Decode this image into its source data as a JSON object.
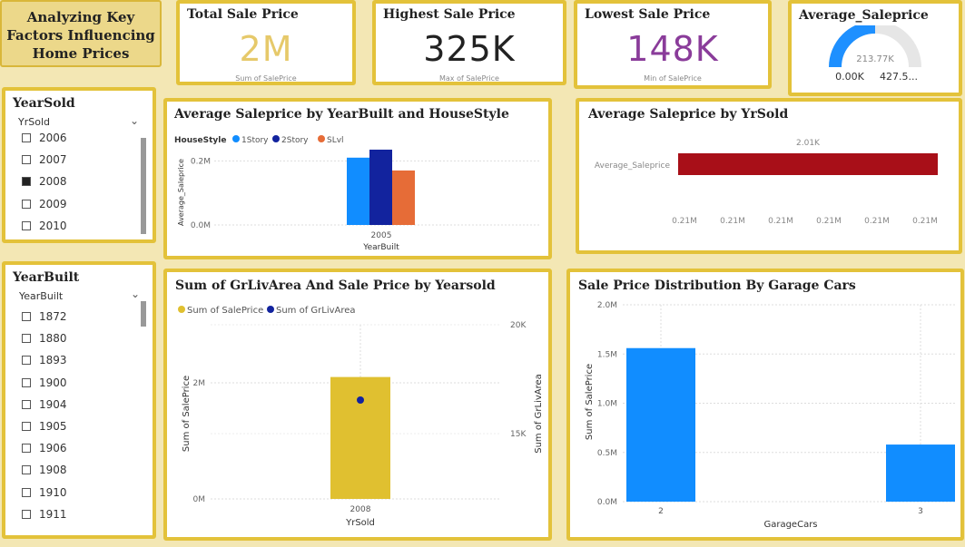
{
  "header": {
    "title_line1": "Analyzing Key",
    "title_line2": "Factors Influencing",
    "title_line3": "Home Prices"
  },
  "kpis": {
    "total": {
      "title": "Total Sale Price",
      "value": "2M",
      "sub": "Sum of SalePrice",
      "color": "#e6c96a"
    },
    "highest": {
      "title": "Highest Sale Price",
      "value": "325K",
      "sub": "Max of SalePrice",
      "color": "#222222"
    },
    "lowest": {
      "title": "Lowest Sale Price",
      "value": "148K",
      "sub": "Min of SalePrice",
      "color": "#8a3c9a"
    }
  },
  "gauge": {
    "title": "Average_Saleprice",
    "value_label": "213.77K",
    "min_label": "0.00K",
    "max_label": "427.5...",
    "fraction": 0.5,
    "color": "#1e90ff"
  },
  "yearsold_slicer": {
    "title": "YearSold",
    "field": "YrSold",
    "items": [
      {
        "label": "2006",
        "checked": false
      },
      {
        "label": "2007",
        "checked": false
      },
      {
        "label": "2008",
        "checked": true
      },
      {
        "label": "2009",
        "checked": false
      },
      {
        "label": "2010",
        "checked": false
      }
    ]
  },
  "yearbuilt_slicer": {
    "title": "YearBuilt",
    "field": "YearBuilt",
    "items": [
      {
        "label": "1872",
        "checked": false
      },
      {
        "label": "1880",
        "checked": false
      },
      {
        "label": "1893",
        "checked": false
      },
      {
        "label": "1900",
        "checked": false
      },
      {
        "label": "1904",
        "checked": false
      },
      {
        "label": "1905",
        "checked": false
      },
      {
        "label": "1906",
        "checked": false
      },
      {
        "label": "1908",
        "checked": false
      },
      {
        "label": "1910",
        "checked": false
      },
      {
        "label": "1911",
        "checked": false
      }
    ]
  },
  "chart_data": [
    {
      "id": "housestyle",
      "type": "bar",
      "title": "Average Saleprice by YearBuilt and HouseStyle",
      "legend_title": "HouseStyle",
      "categories": [
        "2005"
      ],
      "xlabel": "YearBuilt",
      "ylabel": "Average_Saleprice",
      "y_ticks": [
        "0.0M",
        "0.2M"
      ],
      "ylim": [
        0,
        0.3
      ],
      "series": [
        {
          "name": "1Story",
          "values": [
            0.21
          ],
          "color": "#118dff"
        },
        {
          "name": "2Story",
          "values": [
            0.235
          ],
          "color": "#12239e"
        },
        {
          "name": "SLvl",
          "values": [
            0.17
          ],
          "color": "#e66c37"
        }
      ]
    },
    {
      "id": "yrsold",
      "type": "bar",
      "title": "Average Saleprice by YrSold",
      "orientation": "horizontal",
      "categories": [
        "Average_Saleprice"
      ],
      "values": [
        0.21
      ],
      "data_label": "2.01K",
      "x_ticks": [
        "0.21M",
        "0.21M",
        "0.21M",
        "0.21M",
        "0.21M",
        "0.21M"
      ],
      "color": "#a80f18"
    },
    {
      "id": "grlivarea",
      "type": "bar",
      "title": "Sum of GrLivArea And Sale Price by Yearsold",
      "categories": [
        "2008"
      ],
      "xlabel": "YrSold",
      "ylabel": "Sum of SalePrice",
      "y2label": "Sum of GrLivArea",
      "y_ticks": [
        "0M",
        "2M"
      ],
      "y2_ticks": [
        "15K",
        "20K"
      ],
      "series": [
        {
          "name": "Sum of SalePrice",
          "values": [
            2.1
          ],
          "color": "#e0c030"
        },
        {
          "name": "Sum of GrLivArea",
          "values": [
            16.5
          ],
          "color": "#12239e"
        }
      ]
    },
    {
      "id": "garage",
      "type": "bar",
      "title": "Sale Price Distribution By Garage Cars",
      "categories": [
        "2",
        "3"
      ],
      "values": [
        1.56,
        0.58
      ],
      "xlabel": "GarageCars",
      "ylabel": "Sum of SalePrice",
      "y_ticks": [
        "0.0M",
        "0.5M",
        "1.0M",
        "1.5M",
        "2.0M"
      ],
      "ylim": [
        0,
        2.0
      ],
      "color": "#118dff"
    }
  ]
}
